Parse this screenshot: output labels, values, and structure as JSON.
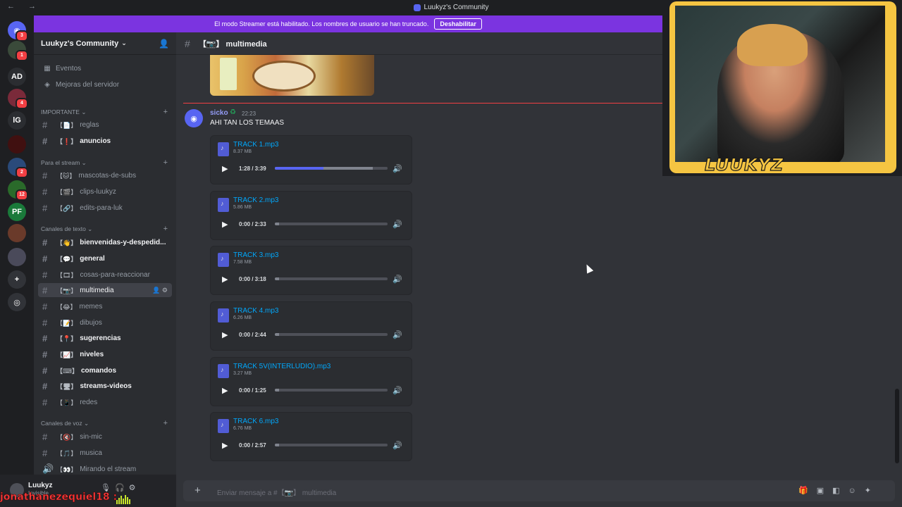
{
  "window": {
    "title": "Luukyz's Community"
  },
  "banner": {
    "text": "El modo Streamer está habilitado. Los nombres de usuario se han truncado.",
    "button": "Deshabilitar"
  },
  "guilds": [
    {
      "label": "",
      "icon": "discord-home-icon",
      "badge": "3"
    },
    {
      "label": "",
      "icon": "server-avatar-icon",
      "badge": "1"
    },
    {
      "label": "AD",
      "icon": "",
      "badge": ""
    },
    {
      "label": "",
      "icon": "server-avatar-icon",
      "badge": "4"
    },
    {
      "label": "lG",
      "icon": "",
      "badge": ""
    },
    {
      "label": "",
      "icon": "server-avatar-icon",
      "badge": ""
    },
    {
      "label": "",
      "icon": "server-avatar-icon",
      "badge": "2"
    },
    {
      "label": "",
      "icon": "server-avatar-icon",
      "badge": "12"
    },
    {
      "label": "PF",
      "icon": "",
      "badge": ""
    },
    {
      "label": "",
      "icon": "server-avatar-icon",
      "badge": ""
    },
    {
      "label": "",
      "icon": "server-avatar-icon",
      "badge": ""
    },
    {
      "label": "",
      "icon": "add-server-icon",
      "badge": ""
    },
    {
      "label": "",
      "icon": "explore-icon",
      "badge": ""
    }
  ],
  "server": {
    "name": "Luukyz's Community"
  },
  "nav": {
    "events": "Eventos",
    "boost": "Mejoras del servidor"
  },
  "categories": {
    "importante": "IMPORTANTE",
    "stream": "Para el stream",
    "texto": "Canales de texto",
    "voz": "Canales de voz"
  },
  "channels": [
    {
      "emoji": "【📄】",
      "name": "reglas",
      "state": "normal"
    },
    {
      "emoji": "【❗】",
      "name": "anuncios",
      "state": "unread"
    },
    {
      "emoji": "【🐱】",
      "name": "mascotas-de-subs",
      "state": "normal"
    },
    {
      "emoji": "【🎬】",
      "name": "clips-luukyz",
      "state": "normal"
    },
    {
      "emoji": "【🔗】",
      "name": "edits-para-luk",
      "state": "normal"
    },
    {
      "emoji": "【👋】",
      "name": "bienvenidas-y-despedid...",
      "state": "unread"
    },
    {
      "emoji": "【💬】",
      "name": "general",
      "state": "unread"
    },
    {
      "emoji": "【🎞】",
      "name": "cosas-para-reaccionar",
      "state": "normal"
    },
    {
      "emoji": "【📷】",
      "name": "multimedia",
      "state": "active"
    },
    {
      "emoji": "【😂】",
      "name": "memes",
      "state": "normal"
    },
    {
      "emoji": "【📝】",
      "name": "dibujos",
      "state": "normal"
    },
    {
      "emoji": "【📍】",
      "name": "sugerencias",
      "state": "unread"
    },
    {
      "emoji": "【📈】",
      "name": "niveles",
      "state": "unread"
    },
    {
      "emoji": "【⌨】",
      "name": "comandos",
      "state": "unread"
    },
    {
      "emoji": "【🖥】",
      "name": "streams-videos",
      "state": "unread"
    },
    {
      "emoji": "【📱】",
      "name": "redes",
      "state": "normal"
    },
    {
      "emoji": "【🔇】",
      "name": "sin-mic",
      "state": "normal"
    },
    {
      "emoji": "【🎵】",
      "name": "musica",
      "state": "normal"
    },
    {
      "emoji": "【👀】",
      "name": "Mirando el stream",
      "state": "voice"
    }
  ],
  "user": {
    "name": "Luukyz",
    "status": "Invisible"
  },
  "overlay": {
    "chatter": "jonathanezequiel18 :"
  },
  "chat": {
    "channel": "【📷】 multimedia",
    "author": "sicko",
    "time": "22:23",
    "text": "AHI TAN LOS TEMAAS",
    "input_placeholder": "Enviar mensaje a #【📷】 multimedia"
  },
  "attachments": [
    {
      "name": "TRACK 1.mp3",
      "size": "8.37 MB",
      "time": "1:28 / 3:39",
      "progress": 0.43,
      "buffered": 0.87
    },
    {
      "name": "TRACK 2.mp3",
      "size": "5.86 MB",
      "time": "0:00 / 2:33",
      "progress": 0.0,
      "buffered": 0.04
    },
    {
      "name": "TRACK 3.mp3",
      "size": "7.58 MB",
      "time": "0:00 / 3:18",
      "progress": 0.0,
      "buffered": 0.04
    },
    {
      "name": "TRACK 4.mp3",
      "size": "6.26 MB",
      "time": "0:00 / 2:44",
      "progress": 0.0,
      "buffered": 0.04
    },
    {
      "name": "TRACK 5V(INTERLUDIO).mp3",
      "size": "3.27 MB",
      "time": "0:00 / 1:25",
      "progress": 0.0,
      "buffered": 0.04
    },
    {
      "name": "TRACK 6.mp3",
      "size": "6.76 MB",
      "time": "0:00 / 2:57",
      "progress": 0.0,
      "buffered": 0.04
    }
  ],
  "webcam": {
    "label": "LUUKYZ"
  },
  "colors": {
    "accent": "#5865f2",
    "banner": "#7b34e0",
    "link": "#00a8fc",
    "danger": "#f23f43",
    "overlay_frame": "#f5c542"
  }
}
